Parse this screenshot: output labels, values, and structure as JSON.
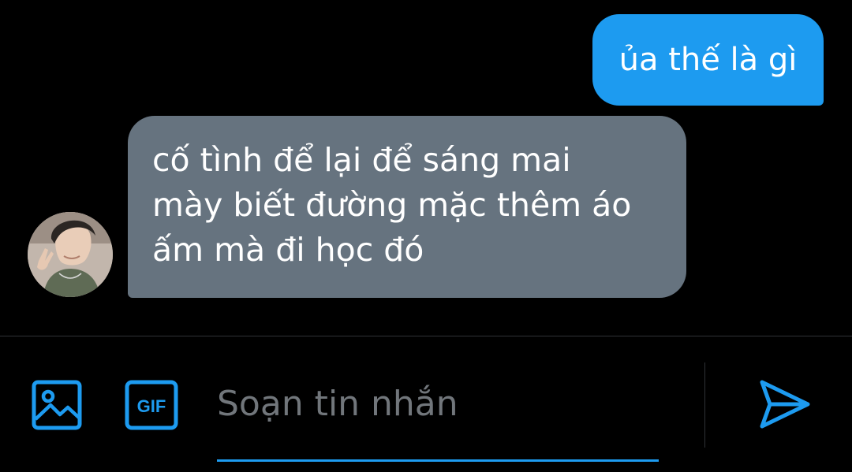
{
  "conversation": {
    "messages": [
      {
        "direction": "sent",
        "text": "ủa thế là gì"
      },
      {
        "direction": "received",
        "lines": [
          "cố tình để lại để sáng mai",
          "mày biết đường mặc thêm áo",
          "ấm mà đi học đó"
        ]
      }
    ]
  },
  "composer": {
    "placeholder": "Soạn tin nhắn",
    "value": "",
    "gif_label": "GIF",
    "icons": [
      "image-icon",
      "gif-icon",
      "send-icon"
    ]
  },
  "colors": {
    "background": "#000000",
    "accent": "#1d9bf0",
    "received_bubble": "#66737f",
    "placeholder": "#71767b",
    "divider": "#2f3336"
  }
}
